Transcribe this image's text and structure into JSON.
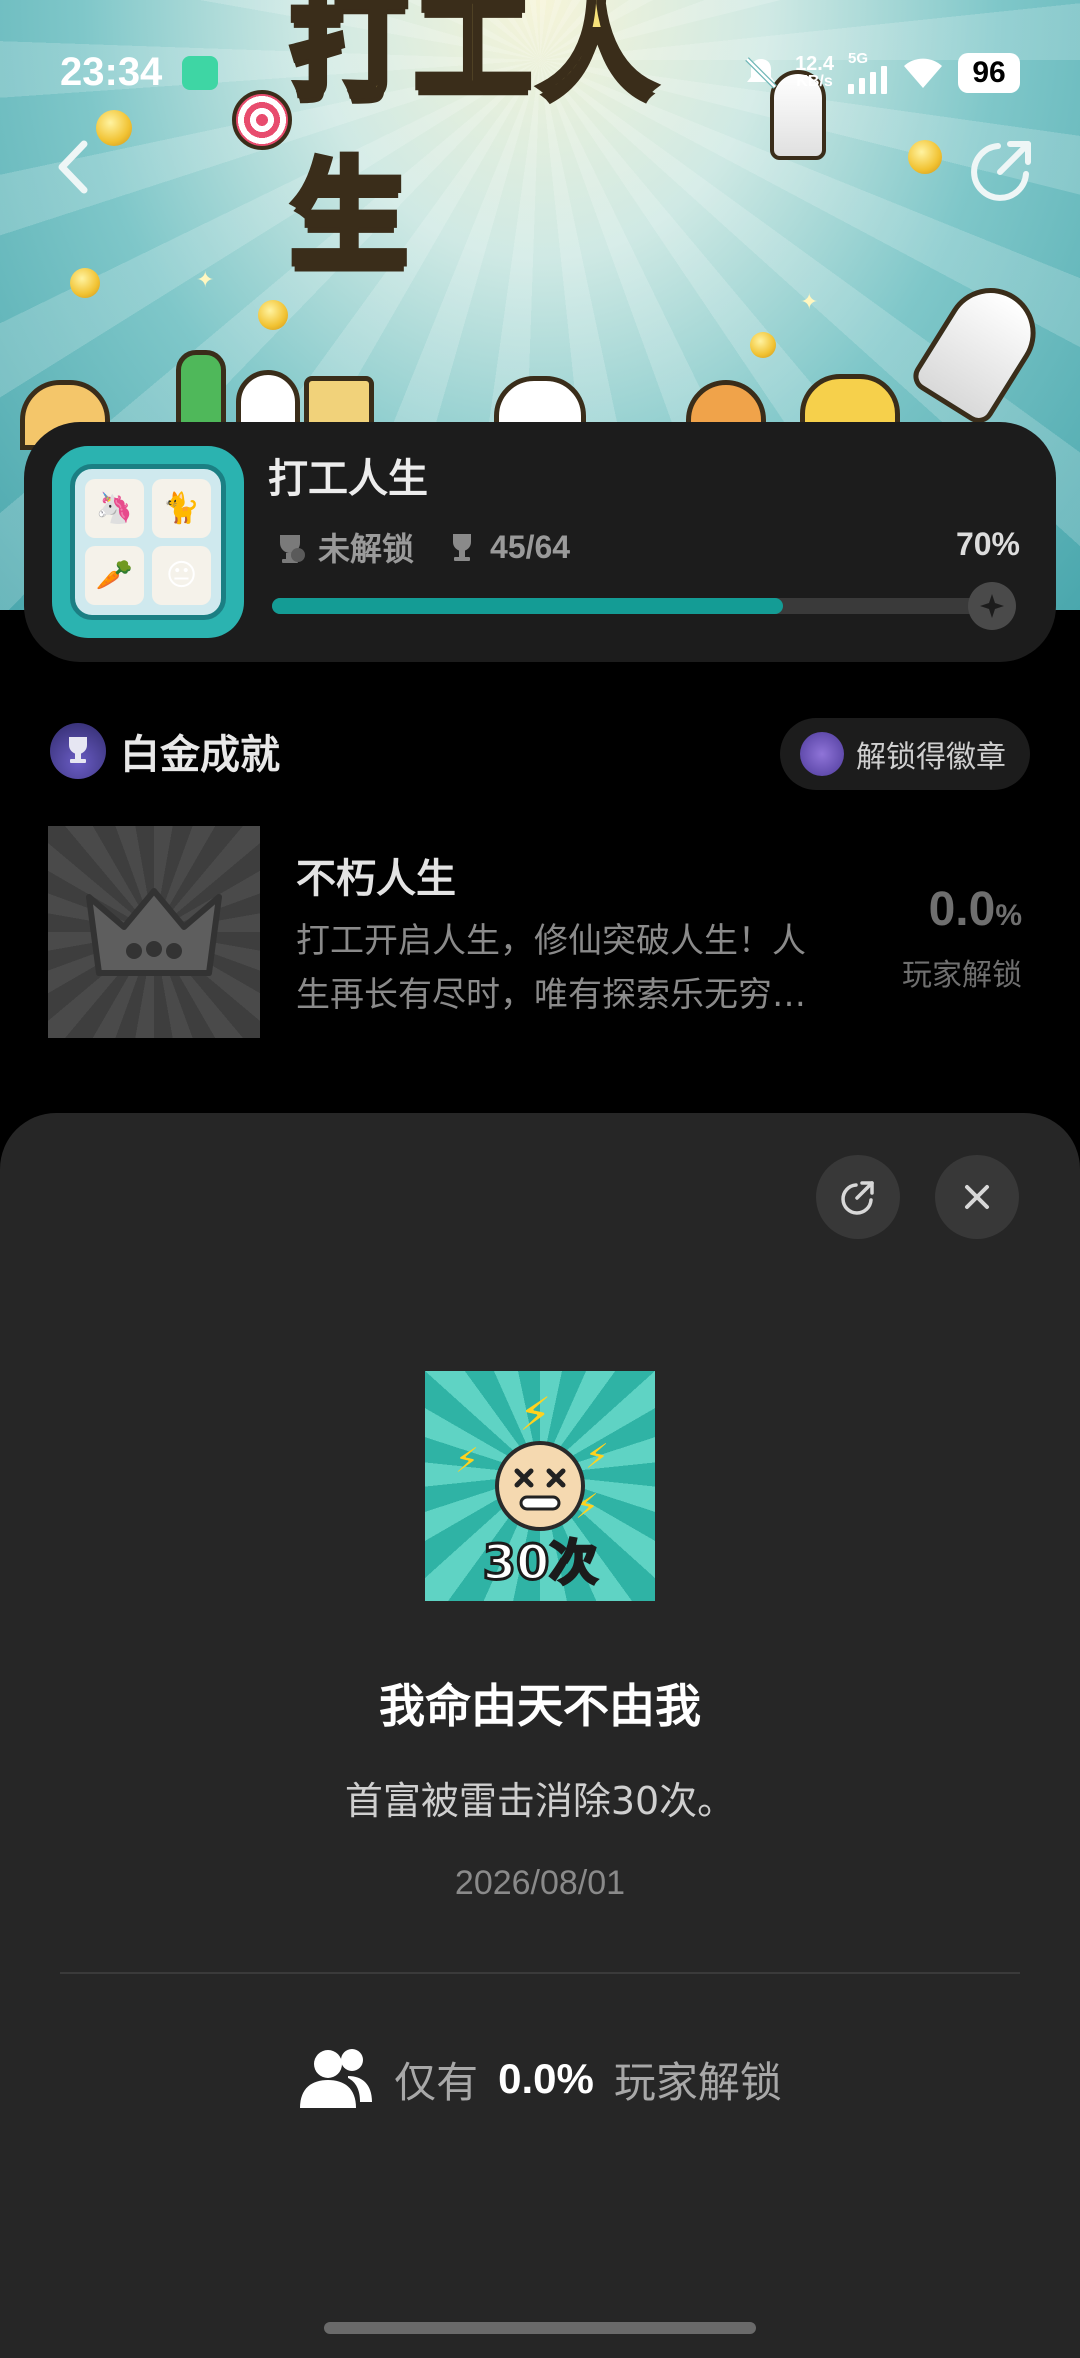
{
  "status_bar": {
    "time": "23:34",
    "net_speed_value": "12.4",
    "net_speed_unit": "KB/s",
    "network": "5G",
    "battery": "96"
  },
  "banner": {
    "title": "打工人生"
  },
  "game": {
    "name": "打工人生",
    "lock_status": "未解锁",
    "trophy_count": "45/64",
    "percent_text": "70%",
    "progress": 0.7
  },
  "platinum": {
    "title": "白金成就",
    "badge_button": "解锁得徽章",
    "achievement": {
      "name": "不朽人生",
      "description": "打工开启人生，修仙突破人生！人生再长有尽时，唯有探索乐无穷…",
      "percent_value": "0.0",
      "percent_unit": "%",
      "percent_label": "玩家解锁"
    }
  },
  "sheet": {
    "medal_text": "30次",
    "title": "我命由天不由我",
    "description": "首富被雷击消除30次。",
    "date": "2026/08/01",
    "stat_prefix": "仅有",
    "stat_value": "0.0%",
    "stat_suffix": "玩家解锁"
  },
  "colors": {
    "accent": "#149c95",
    "card_bg": "#1c1c1c",
    "sheet_bg": "#262626"
  },
  "icons": [
    "back-arrow-icon",
    "share-icon",
    "lock-trophy-icon",
    "trophy-icon",
    "sparkle-icon",
    "platinum-cup-icon",
    "badge-hex-icon",
    "crown-icon",
    "share-icon",
    "close-icon",
    "users-icon"
  ]
}
